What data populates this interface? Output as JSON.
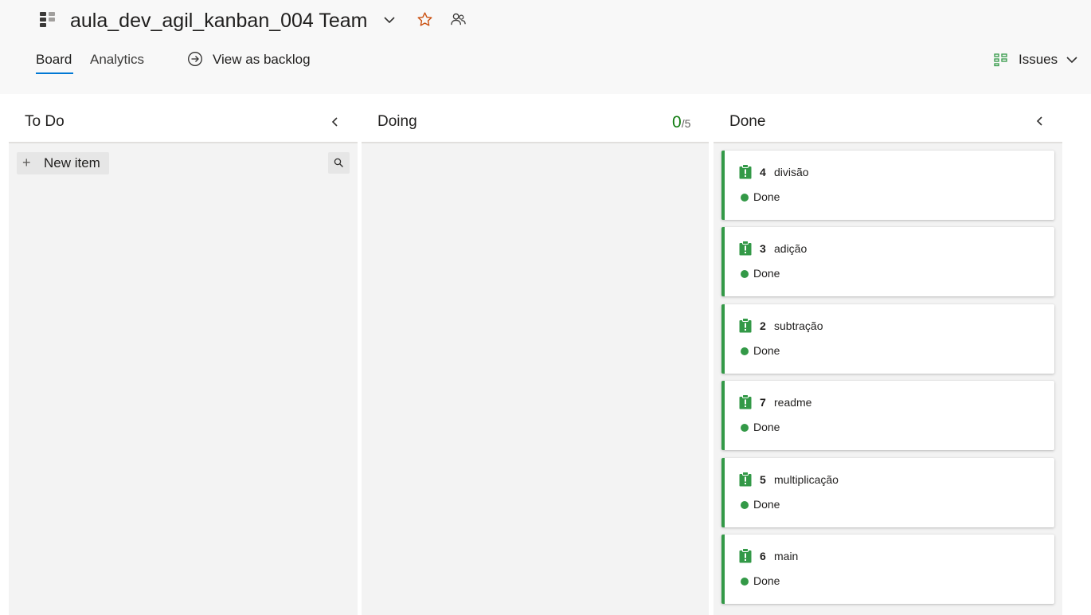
{
  "header": {
    "team_name": "aula_dev_agil_kanban_004 Team",
    "tabs": [
      {
        "label": "Board",
        "selected": true
      },
      {
        "label": "Analytics",
        "selected": false
      }
    ],
    "backlog_link": "View as backlog",
    "backlog_level": "Issues"
  },
  "columns": {
    "todo": {
      "title": "To Do",
      "new_item_label": "New item"
    },
    "doing": {
      "title": "Doing",
      "wip_current": "0",
      "wip_limit": "/5"
    },
    "done": {
      "title": "Done"
    }
  },
  "cards": [
    {
      "id": "4",
      "title": "divisão",
      "state": "Done"
    },
    {
      "id": "3",
      "title": "adição",
      "state": "Done"
    },
    {
      "id": "2",
      "title": "subtração",
      "state": "Done"
    },
    {
      "id": "7",
      "title": "readme",
      "state": "Done"
    },
    {
      "id": "5",
      "title": "multiplicação",
      "state": "Done"
    },
    {
      "id": "6",
      "title": "main",
      "state": "Done"
    }
  ],
  "colors": {
    "accent": "#0078d4",
    "done_green": "#339947",
    "wip_green": "#107c10",
    "star_orange": "#ca5010"
  },
  "icons": {
    "team": "team-board-icon",
    "favorite": "star-icon",
    "members": "people-icon",
    "backlog": "arrow-circle-icon",
    "issue": "issue-icon"
  }
}
